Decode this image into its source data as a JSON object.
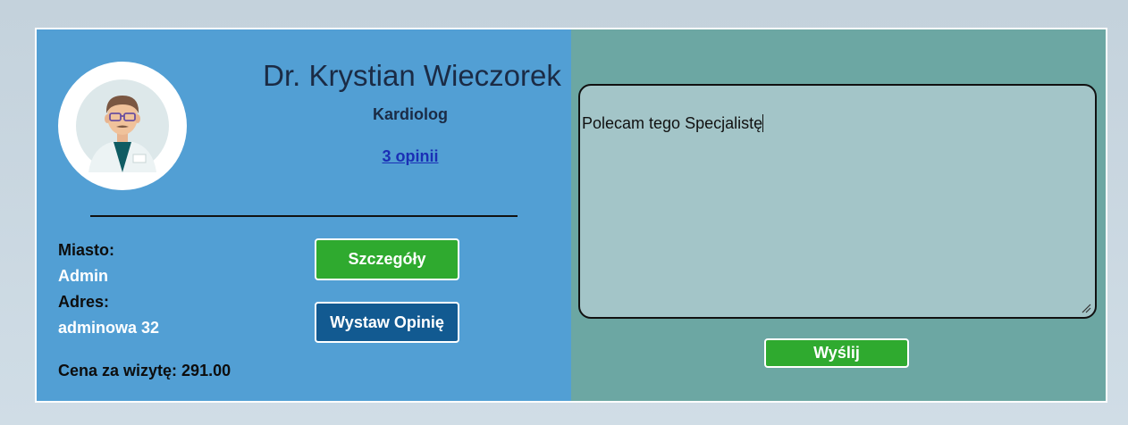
{
  "doctor": {
    "name": "Dr. Krystian Wieczorek",
    "specialty": "Kardiolog",
    "reviews_link": "3 opinii"
  },
  "details": {
    "city_label": "Miasto:",
    "city_value": "Admin",
    "address_label": "Adres:",
    "address_value": "adminowa 32",
    "price_text": "Cena za wizytę: 291.00"
  },
  "buttons": {
    "details_label": "Szczegóły",
    "review_label": "Wystaw Opinię",
    "send_label": "Wyślij"
  },
  "review_form": {
    "text_value": "Polecam tego Specjalistę"
  },
  "colors": {
    "left_panel": "#529fd4",
    "right_panel": "#6ca7a3",
    "green_button": "#2faa2f",
    "blue_button": "#125a91"
  },
  "icons": {
    "avatar": "doctor-avatar-icon",
    "resize": "resize-handle-icon"
  }
}
